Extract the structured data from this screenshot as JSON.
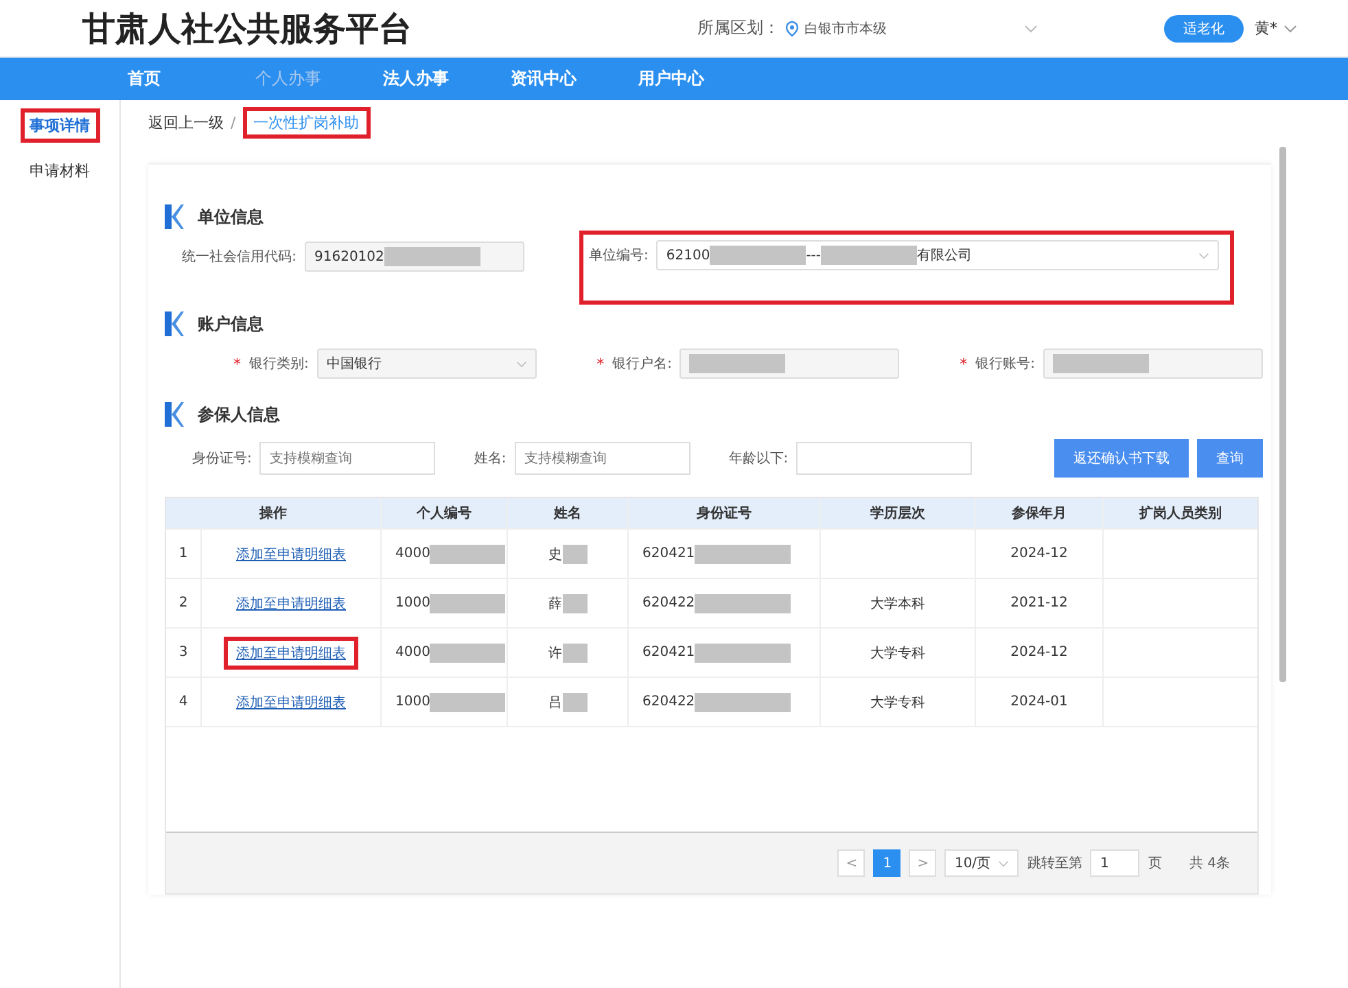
{
  "header": {
    "title": "甘肃人社公共服务平台",
    "region_label": "所属区划：",
    "region_value": "白银市市本级",
    "elder_button": "适老化",
    "user": "黄*"
  },
  "nav": [
    {
      "label": "首页",
      "selected": false
    },
    {
      "label": "个人办事",
      "selected": true
    },
    {
      "label": "法人办事",
      "selected": false
    },
    {
      "label": "资讯中心",
      "selected": false
    },
    {
      "label": "用户中心",
      "selected": false
    }
  ],
  "sidebar": [
    {
      "label": "事项详情",
      "selected": true,
      "highlighted": true
    },
    {
      "label": "申请材料",
      "selected": false,
      "highlighted": false
    }
  ],
  "breadcrumb": {
    "back": "返回上一级",
    "separator": "/",
    "current": "一次性扩岗补助",
    "highlighted": true
  },
  "unit_section": {
    "title": "单位信息",
    "credit_code": {
      "label": "统一社会信用代码:",
      "parts": [
        {
          "kind": "text",
          "text": "91620102"
        },
        {
          "kind": "redacted"
        }
      ]
    },
    "unit_number": {
      "label": "单位编号:",
      "highlighted": true,
      "parts": [
        {
          "kind": "text",
          "text": "62100"
        },
        {
          "kind": "redacted"
        },
        {
          "kind": "text",
          "text": "---"
        },
        {
          "kind": "redacted"
        },
        {
          "kind": "text",
          "text": "有限公司"
        }
      ]
    }
  },
  "account_section": {
    "title": "账户信息",
    "fields": [
      {
        "label": "银行类别:",
        "required_mark": "*",
        "kind": "select",
        "parts": [
          {
            "kind": "text",
            "text": "中国银行"
          }
        ]
      },
      {
        "label": "银行户名:",
        "required_mark": "*",
        "kind": "text",
        "parts": [
          {
            "kind": "redacted"
          }
        ]
      },
      {
        "label": "银行账号:",
        "required_mark": "*",
        "kind": "text",
        "parts": [
          {
            "kind": "redacted"
          }
        ]
      }
    ]
  },
  "insured_section": {
    "title": "参保人信息",
    "filters": [
      {
        "label": "身份证号:",
        "placeholder": "支持模糊查询"
      },
      {
        "label": "姓名:",
        "placeholder": "支持模糊查询"
      },
      {
        "label": "年龄以下:"
      }
    ],
    "buttons": [
      "返还确认书下载",
      "查询"
    ]
  },
  "table": {
    "columns": [
      "操作",
      "个人编号",
      "姓名",
      "身份证号",
      "学历层次",
      "参保年月",
      "扩岗人员类别"
    ],
    "rows": [
      {
        "index": "1",
        "action": "添加至申请明细表",
        "highlighted": false,
        "person_no": "4000",
        "name": "史",
        "id_no": "620421",
        "date": "2024-12"
      },
      {
        "index": "2",
        "action": "添加至申请明细表",
        "highlighted": false,
        "person_no": "1000",
        "name": "薛",
        "id_no": "620422",
        "education": "大学本科",
        "date": "2021-12"
      },
      {
        "index": "3",
        "action": "添加至申请明细表",
        "highlighted": true,
        "person_no": "4000",
        "name": "许",
        "id_no": "620421",
        "education": "大学专科",
        "date": "2024-12"
      },
      {
        "index": "4",
        "action": "添加至申请明细表",
        "highlighted": false,
        "person_no": "1000",
        "name": "吕",
        "id_no": "620422",
        "education": "大学专科",
        "date": "2024-01"
      }
    ]
  },
  "pagination": {
    "prev": "<",
    "pages": [
      {
        "label": "1",
        "selected": true
      }
    ],
    "next": ">",
    "page_size": "10/页",
    "jump_label": "跳转至第",
    "jump_value": "1",
    "page_unit": "页",
    "total": "共 4条"
  }
}
